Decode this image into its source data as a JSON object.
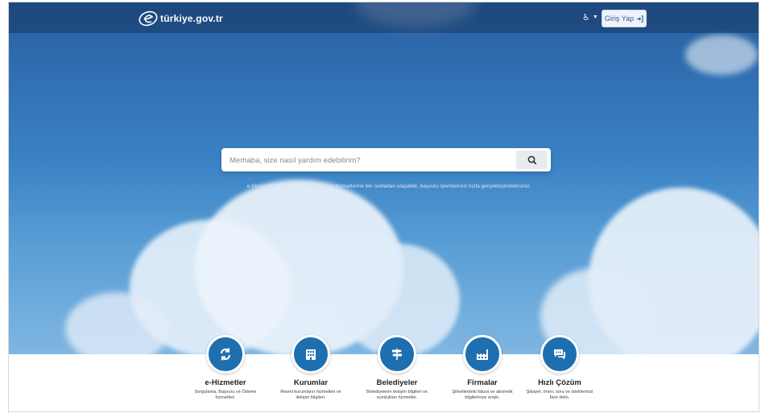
{
  "header": {
    "logo_text": "türkiye.gov.tr",
    "accessibility_label": "♿",
    "login_label": "Giriş Yap"
  },
  "search": {
    "placeholder": "Merhaba, size nasıl yardım edebilirim?",
    "hint": "e-Devlet Kapısı ile kamu kurumlarının hizmetlerine tek noktadan ulaşabilir, başvuru işlemlerinizi hızla gerçekleştirebilirsiniz."
  },
  "categories": [
    {
      "title": "e-Hizmetler",
      "desc": "Sorgulama, Başvuru ve Ödeme hizmetleri.",
      "icon": "refresh-icon"
    },
    {
      "title": "Kurumlar",
      "desc": "Resmi kurumların hizmetleri ve iletişim bilgileri.",
      "icon": "building-icon"
    },
    {
      "title": "Belediyeler",
      "desc": "Belediyelerin iletişim bilgileri ve sundukları hizmetler.",
      "icon": "signpost-icon"
    },
    {
      "title": "Firmalar",
      "desc": "Şirketlerdeki fatura ve abonelik bilgilerinize erişin.",
      "icon": "factory-icon"
    },
    {
      "title": "Hızlı Çözüm",
      "desc": "Şikayet, öneri, soru ve isteklerinizi bize iletin.",
      "icon": "chat-icon"
    }
  ],
  "colors": {
    "accent": "#1d6fb0",
    "sky_top": "#2a5f9e",
    "sky_bottom": "#7fb6e2"
  }
}
